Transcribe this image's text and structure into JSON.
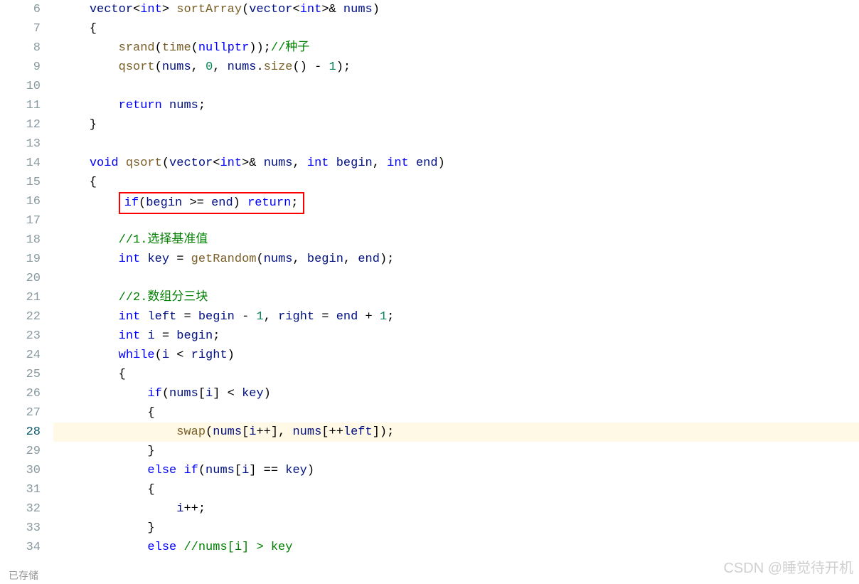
{
  "lines": [
    {
      "n": 6,
      "tokens": [
        [
          "    ",
          ""
        ],
        [
          "vector",
          "id"
        ],
        [
          "<",
          "pun"
        ],
        [
          "int",
          "kw"
        ],
        [
          "> ",
          "pun"
        ],
        [
          "sortArray",
          "fn"
        ],
        [
          "(",
          "pun"
        ],
        [
          "vector",
          "id"
        ],
        [
          "<",
          "pun"
        ],
        [
          "int",
          "kw"
        ],
        [
          ">& ",
          "pun"
        ],
        [
          "nums",
          "id"
        ],
        [
          ")",
          "pun"
        ]
      ]
    },
    {
      "n": 7,
      "tokens": [
        [
          "    {",
          ""
        ]
      ]
    },
    {
      "n": 8,
      "tokens": [
        [
          "        ",
          ""
        ],
        [
          "srand",
          "fn"
        ],
        [
          "(",
          "pun"
        ],
        [
          "time",
          "fn"
        ],
        [
          "(",
          "pun"
        ],
        [
          "nullptr",
          "kw"
        ],
        [
          "));",
          "pun"
        ],
        [
          "//种子",
          "cmt"
        ]
      ]
    },
    {
      "n": 9,
      "tokens": [
        [
          "        ",
          ""
        ],
        [
          "qsort",
          "fn"
        ],
        [
          "(",
          "pun"
        ],
        [
          "nums",
          "id"
        ],
        [
          ", ",
          "pun"
        ],
        [
          "0",
          "num"
        ],
        [
          ", ",
          "pun"
        ],
        [
          "nums",
          "id"
        ],
        [
          ".",
          "pun"
        ],
        [
          "size",
          "fn"
        ],
        [
          "() - ",
          "pun"
        ],
        [
          "1",
          "num"
        ],
        [
          ");",
          "pun"
        ]
      ]
    },
    {
      "n": 10,
      "tokens": [
        [
          "",
          ""
        ]
      ]
    },
    {
      "n": 11,
      "tokens": [
        [
          "        ",
          ""
        ],
        [
          "return",
          "kw"
        ],
        [
          " ",
          "pun"
        ],
        [
          "nums",
          "id"
        ],
        [
          ";",
          "pun"
        ]
      ]
    },
    {
      "n": 12,
      "tokens": [
        [
          "    }",
          ""
        ]
      ]
    },
    {
      "n": 13,
      "tokens": [
        [
          "",
          ""
        ]
      ]
    },
    {
      "n": 14,
      "tokens": [
        [
          "    ",
          ""
        ],
        [
          "void",
          "kw"
        ],
        [
          " ",
          "pun"
        ],
        [
          "qsort",
          "fn"
        ],
        [
          "(",
          "pun"
        ],
        [
          "vector",
          "id"
        ],
        [
          "<",
          "pun"
        ],
        [
          "int",
          "kw"
        ],
        [
          ">& ",
          "pun"
        ],
        [
          "nums",
          "id"
        ],
        [
          ", ",
          "pun"
        ],
        [
          "int",
          "kw"
        ],
        [
          " ",
          "pun"
        ],
        [
          "begin",
          "id"
        ],
        [
          ", ",
          "pun"
        ],
        [
          "int",
          "kw"
        ],
        [
          " ",
          "pun"
        ],
        [
          "end",
          "id"
        ],
        [
          ")",
          "pun"
        ]
      ]
    },
    {
      "n": 15,
      "tokens": [
        [
          "    {",
          ""
        ]
      ]
    },
    {
      "n": 16,
      "redbox": true,
      "tokens": [
        [
          "if",
          "kw"
        ],
        [
          "(",
          "pun"
        ],
        [
          "begin",
          "id"
        ],
        [
          " >= ",
          "pun"
        ],
        [
          "end",
          "id"
        ],
        [
          ") ",
          "pun"
        ],
        [
          "return",
          "kw"
        ],
        [
          ";",
          "pun"
        ]
      ]
    },
    {
      "n": 17,
      "tokens": [
        [
          "",
          ""
        ]
      ]
    },
    {
      "n": 18,
      "tokens": [
        [
          "        ",
          ""
        ],
        [
          "//1.选择基准值",
          "cmt"
        ]
      ]
    },
    {
      "n": 19,
      "tokens": [
        [
          "        ",
          ""
        ],
        [
          "int",
          "kw"
        ],
        [
          " ",
          "pun"
        ],
        [
          "key",
          "id"
        ],
        [
          " = ",
          "pun"
        ],
        [
          "getRandom",
          "fn"
        ],
        [
          "(",
          "pun"
        ],
        [
          "nums",
          "id"
        ],
        [
          ", ",
          "pun"
        ],
        [
          "begin",
          "id"
        ],
        [
          ", ",
          "pun"
        ],
        [
          "end",
          "id"
        ],
        [
          ");",
          "pun"
        ]
      ]
    },
    {
      "n": 20,
      "tokens": [
        [
          "",
          ""
        ]
      ]
    },
    {
      "n": 21,
      "tokens": [
        [
          "        ",
          ""
        ],
        [
          "//2.数组分三块",
          "cmt"
        ]
      ]
    },
    {
      "n": 22,
      "tokens": [
        [
          "        ",
          ""
        ],
        [
          "int",
          "kw"
        ],
        [
          " ",
          "pun"
        ],
        [
          "left",
          "id"
        ],
        [
          " = ",
          "pun"
        ],
        [
          "begin",
          "id"
        ],
        [
          " - ",
          "pun"
        ],
        [
          "1",
          "num"
        ],
        [
          ", ",
          "pun"
        ],
        [
          "right",
          "id"
        ],
        [
          " = ",
          "pun"
        ],
        [
          "end",
          "id"
        ],
        [
          " + ",
          "pun"
        ],
        [
          "1",
          "num"
        ],
        [
          ";",
          "pun"
        ]
      ]
    },
    {
      "n": 23,
      "tokens": [
        [
          "        ",
          ""
        ],
        [
          "int",
          "kw"
        ],
        [
          " ",
          "pun"
        ],
        [
          "i",
          "id"
        ],
        [
          " = ",
          "pun"
        ],
        [
          "begin",
          "id"
        ],
        [
          ";",
          "pun"
        ]
      ]
    },
    {
      "n": 24,
      "tokens": [
        [
          "        ",
          ""
        ],
        [
          "while",
          "kw"
        ],
        [
          "(",
          "pun"
        ],
        [
          "i",
          "id"
        ],
        [
          " < ",
          "pun"
        ],
        [
          "right",
          "id"
        ],
        [
          ")",
          "pun"
        ]
      ]
    },
    {
      "n": 25,
      "tokens": [
        [
          "        {",
          ""
        ]
      ]
    },
    {
      "n": 26,
      "tokens": [
        [
          "            ",
          ""
        ],
        [
          "if",
          "kw"
        ],
        [
          "(",
          "pun"
        ],
        [
          "nums",
          "id"
        ],
        [
          "[",
          "pun"
        ],
        [
          "i",
          "id"
        ],
        [
          "] < ",
          "pun"
        ],
        [
          "key",
          "id"
        ],
        [
          ")",
          "pun"
        ]
      ]
    },
    {
      "n": 27,
      "tokens": [
        [
          "            {",
          ""
        ]
      ]
    },
    {
      "n": 28,
      "tokens": [
        [
          "                ",
          ""
        ],
        [
          "swap",
          "fn"
        ],
        [
          "(",
          "pun"
        ],
        [
          "nums",
          "id"
        ],
        [
          "[",
          "pun"
        ],
        [
          "i",
          "id"
        ],
        [
          "++], ",
          "pun"
        ],
        [
          "nums",
          "id"
        ],
        [
          "[++",
          "pun"
        ],
        [
          "left",
          "id"
        ],
        [
          "]);",
          "pun"
        ]
      ]
    },
    {
      "n": 29,
      "tokens": [
        [
          "            }",
          ""
        ]
      ]
    },
    {
      "n": 30,
      "tokens": [
        [
          "            ",
          ""
        ],
        [
          "else",
          "kw"
        ],
        [
          " ",
          "pun"
        ],
        [
          "if",
          "kw"
        ],
        [
          "(",
          "pun"
        ],
        [
          "nums",
          "id"
        ],
        [
          "[",
          "pun"
        ],
        [
          "i",
          "id"
        ],
        [
          "] == ",
          "pun"
        ],
        [
          "key",
          "id"
        ],
        [
          ")",
          "pun"
        ]
      ]
    },
    {
      "n": 31,
      "tokens": [
        [
          "            {",
          ""
        ]
      ]
    },
    {
      "n": 32,
      "tokens": [
        [
          "                ",
          ""
        ],
        [
          "i",
          "id"
        ],
        [
          "++;",
          "pun"
        ]
      ]
    },
    {
      "n": 33,
      "tokens": [
        [
          "            }",
          ""
        ]
      ]
    },
    {
      "n": 34,
      "tokens": [
        [
          "            ",
          ""
        ],
        [
          "else",
          "kw"
        ],
        [
          " ",
          "pun"
        ],
        [
          "//nums[i] > key",
          "cmt"
        ]
      ]
    }
  ],
  "active_line": 28,
  "status_text": "已存储",
  "watermark": "CSDN @睡觉待开机"
}
